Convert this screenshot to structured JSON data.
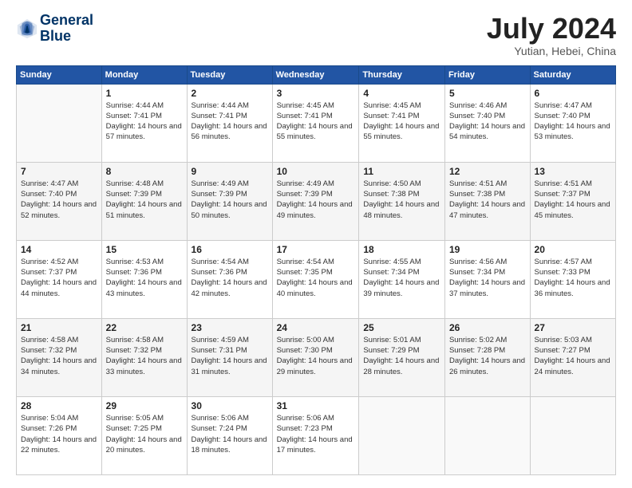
{
  "header": {
    "logo_line1": "General",
    "logo_line2": "Blue",
    "month_year": "July 2024",
    "location": "Yutian, Hebei, China"
  },
  "days_of_week": [
    "Sunday",
    "Monday",
    "Tuesday",
    "Wednesday",
    "Thursday",
    "Friday",
    "Saturday"
  ],
  "weeks": [
    [
      {
        "day": "",
        "sunrise": "",
        "sunset": "",
        "daylight": ""
      },
      {
        "day": "1",
        "sunrise": "Sunrise: 4:44 AM",
        "sunset": "Sunset: 7:41 PM",
        "daylight": "Daylight: 14 hours and 57 minutes."
      },
      {
        "day": "2",
        "sunrise": "Sunrise: 4:44 AM",
        "sunset": "Sunset: 7:41 PM",
        "daylight": "Daylight: 14 hours and 56 minutes."
      },
      {
        "day": "3",
        "sunrise": "Sunrise: 4:45 AM",
        "sunset": "Sunset: 7:41 PM",
        "daylight": "Daylight: 14 hours and 55 minutes."
      },
      {
        "day": "4",
        "sunrise": "Sunrise: 4:45 AM",
        "sunset": "Sunset: 7:41 PM",
        "daylight": "Daylight: 14 hours and 55 minutes."
      },
      {
        "day": "5",
        "sunrise": "Sunrise: 4:46 AM",
        "sunset": "Sunset: 7:40 PM",
        "daylight": "Daylight: 14 hours and 54 minutes."
      },
      {
        "day": "6",
        "sunrise": "Sunrise: 4:47 AM",
        "sunset": "Sunset: 7:40 PM",
        "daylight": "Daylight: 14 hours and 53 minutes."
      }
    ],
    [
      {
        "day": "7",
        "sunrise": "Sunrise: 4:47 AM",
        "sunset": "Sunset: 7:40 PM",
        "daylight": "Daylight: 14 hours and 52 minutes."
      },
      {
        "day": "8",
        "sunrise": "Sunrise: 4:48 AM",
        "sunset": "Sunset: 7:39 PM",
        "daylight": "Daylight: 14 hours and 51 minutes."
      },
      {
        "day": "9",
        "sunrise": "Sunrise: 4:49 AM",
        "sunset": "Sunset: 7:39 PM",
        "daylight": "Daylight: 14 hours and 50 minutes."
      },
      {
        "day": "10",
        "sunrise": "Sunrise: 4:49 AM",
        "sunset": "Sunset: 7:39 PM",
        "daylight": "Daylight: 14 hours and 49 minutes."
      },
      {
        "day": "11",
        "sunrise": "Sunrise: 4:50 AM",
        "sunset": "Sunset: 7:38 PM",
        "daylight": "Daylight: 14 hours and 48 minutes."
      },
      {
        "day": "12",
        "sunrise": "Sunrise: 4:51 AM",
        "sunset": "Sunset: 7:38 PM",
        "daylight": "Daylight: 14 hours and 47 minutes."
      },
      {
        "day": "13",
        "sunrise": "Sunrise: 4:51 AM",
        "sunset": "Sunset: 7:37 PM",
        "daylight": "Daylight: 14 hours and 45 minutes."
      }
    ],
    [
      {
        "day": "14",
        "sunrise": "Sunrise: 4:52 AM",
        "sunset": "Sunset: 7:37 PM",
        "daylight": "Daylight: 14 hours and 44 minutes."
      },
      {
        "day": "15",
        "sunrise": "Sunrise: 4:53 AM",
        "sunset": "Sunset: 7:36 PM",
        "daylight": "Daylight: 14 hours and 43 minutes."
      },
      {
        "day": "16",
        "sunrise": "Sunrise: 4:54 AM",
        "sunset": "Sunset: 7:36 PM",
        "daylight": "Daylight: 14 hours and 42 minutes."
      },
      {
        "day": "17",
        "sunrise": "Sunrise: 4:54 AM",
        "sunset": "Sunset: 7:35 PM",
        "daylight": "Daylight: 14 hours and 40 minutes."
      },
      {
        "day": "18",
        "sunrise": "Sunrise: 4:55 AM",
        "sunset": "Sunset: 7:34 PM",
        "daylight": "Daylight: 14 hours and 39 minutes."
      },
      {
        "day": "19",
        "sunrise": "Sunrise: 4:56 AM",
        "sunset": "Sunset: 7:34 PM",
        "daylight": "Daylight: 14 hours and 37 minutes."
      },
      {
        "day": "20",
        "sunrise": "Sunrise: 4:57 AM",
        "sunset": "Sunset: 7:33 PM",
        "daylight": "Daylight: 14 hours and 36 minutes."
      }
    ],
    [
      {
        "day": "21",
        "sunrise": "Sunrise: 4:58 AM",
        "sunset": "Sunset: 7:32 PM",
        "daylight": "Daylight: 14 hours and 34 minutes."
      },
      {
        "day": "22",
        "sunrise": "Sunrise: 4:58 AM",
        "sunset": "Sunset: 7:32 PM",
        "daylight": "Daylight: 14 hours and 33 minutes."
      },
      {
        "day": "23",
        "sunrise": "Sunrise: 4:59 AM",
        "sunset": "Sunset: 7:31 PM",
        "daylight": "Daylight: 14 hours and 31 minutes."
      },
      {
        "day": "24",
        "sunrise": "Sunrise: 5:00 AM",
        "sunset": "Sunset: 7:30 PM",
        "daylight": "Daylight: 14 hours and 29 minutes."
      },
      {
        "day": "25",
        "sunrise": "Sunrise: 5:01 AM",
        "sunset": "Sunset: 7:29 PM",
        "daylight": "Daylight: 14 hours and 28 minutes."
      },
      {
        "day": "26",
        "sunrise": "Sunrise: 5:02 AM",
        "sunset": "Sunset: 7:28 PM",
        "daylight": "Daylight: 14 hours and 26 minutes."
      },
      {
        "day": "27",
        "sunrise": "Sunrise: 5:03 AM",
        "sunset": "Sunset: 7:27 PM",
        "daylight": "Daylight: 14 hours and 24 minutes."
      }
    ],
    [
      {
        "day": "28",
        "sunrise": "Sunrise: 5:04 AM",
        "sunset": "Sunset: 7:26 PM",
        "daylight": "Daylight: 14 hours and 22 minutes."
      },
      {
        "day": "29",
        "sunrise": "Sunrise: 5:05 AM",
        "sunset": "Sunset: 7:25 PM",
        "daylight": "Daylight: 14 hours and 20 minutes."
      },
      {
        "day": "30",
        "sunrise": "Sunrise: 5:06 AM",
        "sunset": "Sunset: 7:24 PM",
        "daylight": "Daylight: 14 hours and 18 minutes."
      },
      {
        "day": "31",
        "sunrise": "Sunrise: 5:06 AM",
        "sunset": "Sunset: 7:23 PM",
        "daylight": "Daylight: 14 hours and 17 minutes."
      },
      {
        "day": "",
        "sunrise": "",
        "sunset": "",
        "daylight": ""
      },
      {
        "day": "",
        "sunrise": "",
        "sunset": "",
        "daylight": ""
      },
      {
        "day": "",
        "sunrise": "",
        "sunset": "",
        "daylight": ""
      }
    ]
  ]
}
